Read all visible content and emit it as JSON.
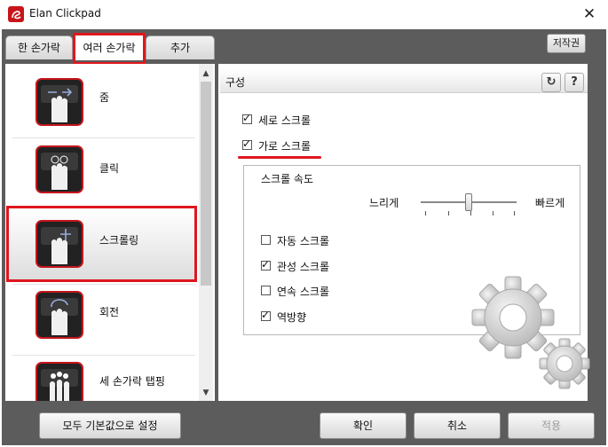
{
  "window": {
    "title": "Elan Clickpad",
    "close_symbol": "✕"
  },
  "tabs": [
    {
      "label": "한 손가락",
      "active": false
    },
    {
      "label": "여러 손가락",
      "active": true
    },
    {
      "label": "추가",
      "active": false
    }
  ],
  "copyright_label": "저작권",
  "gestures": [
    {
      "label": "줌",
      "icon": "zoom-gesture-icon",
      "selected": false
    },
    {
      "label": "클릭",
      "icon": "click-gesture-icon",
      "selected": false
    },
    {
      "label": "스크롤링",
      "icon": "scrolling-gesture-icon",
      "selected": true
    },
    {
      "label": "회전",
      "icon": "rotate-gesture-icon",
      "selected": false
    },
    {
      "label": "세 손가락 탭핑",
      "icon": "three-finger-tap-icon",
      "selected": false
    }
  ],
  "config": {
    "header": "구성",
    "refresh_symbol": "↻",
    "help_symbol": "?",
    "vertical_scroll": {
      "label": "세로 스크롤",
      "checked": true
    },
    "horizontal_scroll": {
      "label": "가로 스크롤",
      "checked": true
    },
    "scroll_speed": {
      "label": "스크롤 속도",
      "slow_label": "느리게",
      "fast_label": "빠르게",
      "value_fraction": 0.5
    },
    "options": [
      {
        "label": "자동 스크롤",
        "checked": false
      },
      {
        "label": "관성 스크롤",
        "checked": true
      },
      {
        "label": "연속 스크롤",
        "checked": false
      },
      {
        "label": "역방향",
        "checked": true
      }
    ]
  },
  "buttons": {
    "reset_defaults": "모두 기본값으로 설정",
    "ok": "확인",
    "cancel": "취소",
    "apply": "적용"
  },
  "colors": {
    "accent_red": "#e0161e",
    "chrome": "#5c5c5c"
  }
}
